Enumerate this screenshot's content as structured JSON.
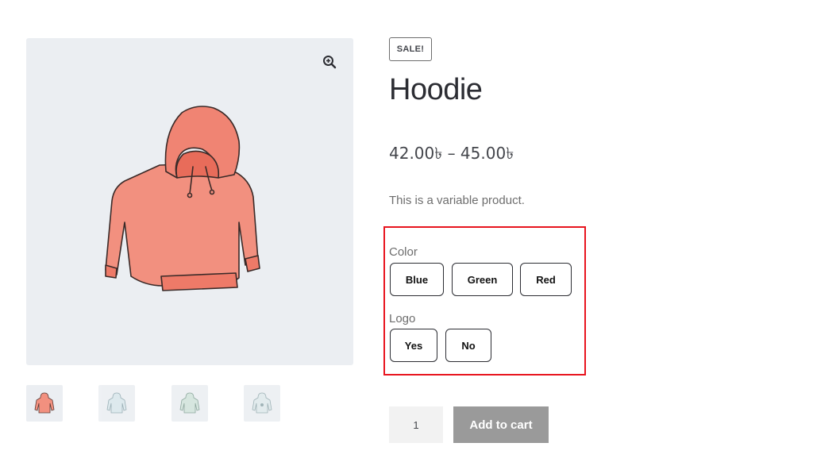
{
  "product": {
    "badge": "SALE!",
    "title": "Hoodie",
    "price": "42.00৳ – 45.00৳",
    "description": "This is a variable product."
  },
  "gallery": {
    "main_image_icon": "hoodie-image",
    "zoom_icon": "zoom-in-icon",
    "thumbnails": [
      {
        "icon": "hoodie-red-thumbnail"
      },
      {
        "icon": "hoodie-blue-thumbnail"
      },
      {
        "icon": "hoodie-green-thumbnail"
      },
      {
        "icon": "hoodie-logo-thumbnail"
      }
    ]
  },
  "attributes": {
    "color": {
      "label": "Color",
      "options": [
        "Blue",
        "Green",
        "Red"
      ]
    },
    "logo": {
      "label": "Logo",
      "options": [
        "Yes",
        "No"
      ]
    }
  },
  "cart": {
    "quantity": "1",
    "add_label": "Add to cart"
  },
  "colors": {
    "highlight": "#e8141e",
    "gallery_bg": "#ebeef2",
    "hoodie": "#f2907f",
    "button_disabled": "#9a9a9a"
  }
}
